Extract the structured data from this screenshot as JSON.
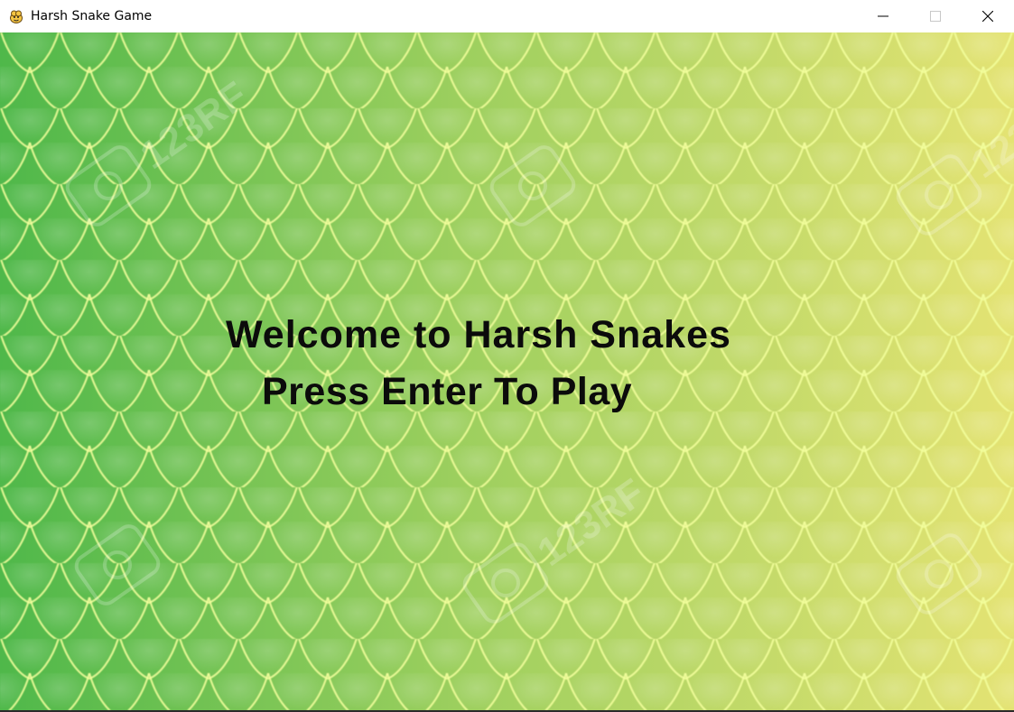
{
  "window": {
    "title": "Harsh Snake Game",
    "icon": "pygame-snake-icon",
    "controls": [
      "minimize-icon",
      "maximize-icon",
      "close-icon"
    ]
  },
  "game": {
    "welcome_text": "Welcome to Harsh Snakes",
    "prompt_text": "Press Enter To Play",
    "background": {
      "pattern": "snake-scales",
      "color_left": "#4fb84a",
      "color_right": "#e4e373",
      "scale_outline": "#f4ff9a",
      "watermark": "123RF"
    },
    "text_color": "#0b0b0b"
  }
}
